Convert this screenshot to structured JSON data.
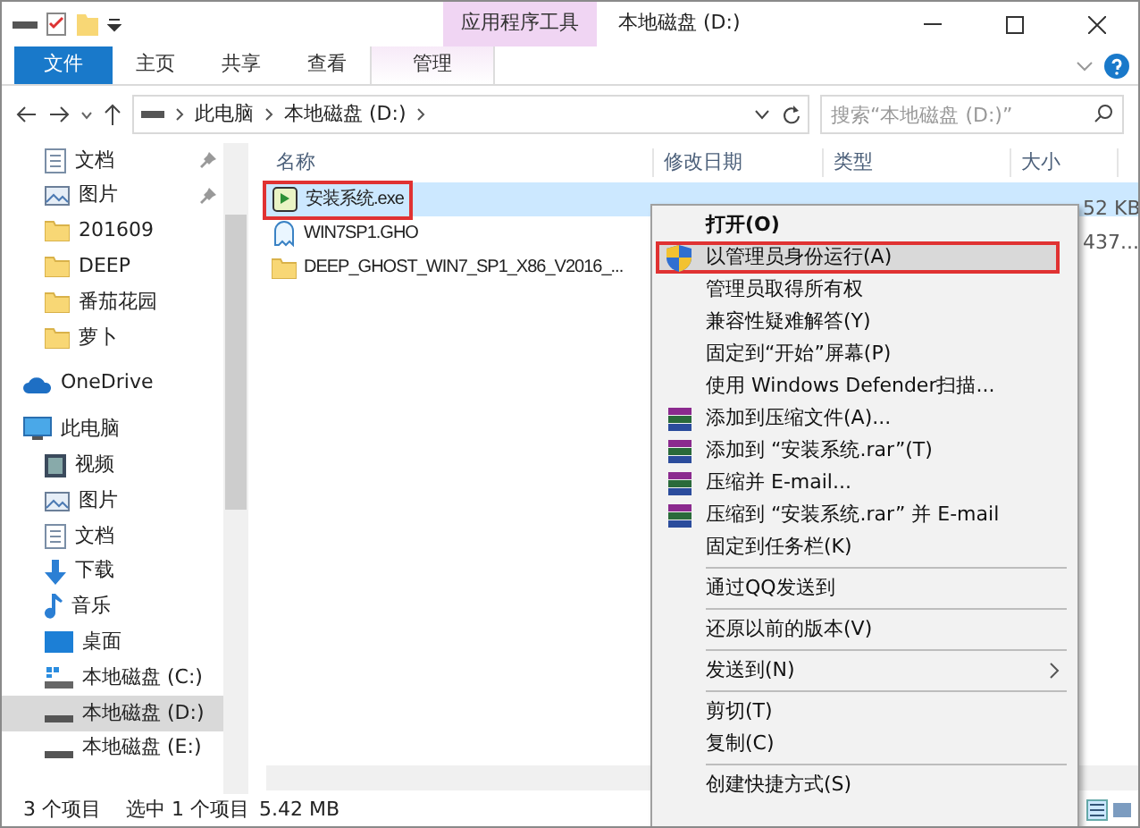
{
  "window": {
    "title": "本地磁盘 (D:)",
    "contextual_tab_group": "应用程序工具"
  },
  "ribbon_tabs": [
    {
      "label": "文件",
      "kind": "file",
      "selected": false
    },
    {
      "label": "主页",
      "kind": "normal",
      "selected": false
    },
    {
      "label": "共享",
      "kind": "normal",
      "selected": false
    },
    {
      "label": "查看",
      "kind": "normal",
      "selected": false
    },
    {
      "label": "管理",
      "kind": "contextual",
      "selected": false
    }
  ],
  "address_bar": {
    "breadcrumbs": [
      "此电脑",
      "本地磁盘 (D:)"
    ]
  },
  "search": {
    "placeholder": "搜索“本地磁盘 (D:)”"
  },
  "nav_tree": [
    {
      "label": "文档",
      "kind": "doc",
      "pinned": true,
      "selected": false
    },
    {
      "label": "图片",
      "kind": "pic",
      "pinned": true,
      "selected": false
    },
    {
      "label": "201609",
      "kind": "folder",
      "pinned": false,
      "selected": false
    },
    {
      "label": "DEEP",
      "kind": "folder",
      "pinned": false,
      "selected": false
    },
    {
      "label": "番茄花园",
      "kind": "folder",
      "pinned": false,
      "selected": false
    },
    {
      "label": "萝卜",
      "kind": "folder",
      "pinned": false,
      "selected": false
    },
    {
      "label": "OneDrive",
      "kind": "cloud",
      "pinned": false,
      "selected": false
    },
    {
      "label": "此电脑",
      "kind": "pc",
      "pinned": false,
      "selected": false,
      "children": [
        {
          "label": "视频",
          "kind": "video",
          "pinned": false,
          "selected": false
        },
        {
          "label": "图片",
          "kind": "pic",
          "pinned": false,
          "selected": false
        },
        {
          "label": "文档",
          "kind": "doc",
          "pinned": false,
          "selected": false
        },
        {
          "label": "下载",
          "kind": "download",
          "pinned": false,
          "selected": false
        },
        {
          "label": "音乐",
          "kind": "music",
          "pinned": false,
          "selected": false
        },
        {
          "label": "桌面",
          "kind": "desktop",
          "pinned": false,
          "selected": false
        },
        {
          "label": "本地磁盘 (C:)",
          "kind": "sysdrive",
          "pinned": false,
          "selected": false
        },
        {
          "label": "本地磁盘 (D:)",
          "kind": "drive",
          "pinned": false,
          "selected": true
        },
        {
          "label": "本地磁盘 (E:)",
          "kind": "drive",
          "pinned": false,
          "selected": false
        }
      ]
    }
  ],
  "table": {
    "columns": [
      "名称",
      "修改日期",
      "类型",
      "大小"
    ],
    "rows": [
      {
        "name": "安装系统.exe",
        "kind": "exe",
        "size": "52 KB",
        "selected": true,
        "outlined": true
      },
      {
        "name": "WIN7SP1.GHO",
        "kind": "gho",
        "size": "437...",
        "selected": false,
        "outlined": false
      },
      {
        "name": "DEEP_GHOST_WIN7_SP1_X86_V2016_...",
        "kind": "folder",
        "selected": false,
        "outlined": false
      }
    ]
  },
  "context_menu": [
    {
      "kind": "default",
      "label": "打开(O)",
      "selected": false,
      "outlined": false
    },
    {
      "kind": "admin",
      "label": "以管理员身份运行(A)",
      "selected": true,
      "outlined": true
    },
    {
      "kind": "item",
      "label": "管理员取得所有权",
      "selected": false,
      "outlined": false
    },
    {
      "kind": "item",
      "label": "兼容性疑难解答(Y)",
      "selected": false,
      "outlined": false
    },
    {
      "kind": "item",
      "label": "固定到“开始”屏幕(P)",
      "selected": false,
      "outlined": false
    },
    {
      "kind": "item",
      "label": "使用 Windows Defender扫描...",
      "selected": false,
      "outlined": false
    },
    {
      "kind": "archive",
      "label": "添加到压缩文件(A)...",
      "selected": false,
      "outlined": false
    },
    {
      "kind": "archive",
      "label": "添加到 “安装系统.rar”(T)",
      "selected": false,
      "outlined": false
    },
    {
      "kind": "archive",
      "label": "压缩并 E-mail...",
      "selected": false,
      "outlined": false
    },
    {
      "kind": "archive",
      "label": "压缩到 “安装系统.rar” 并 E-mail",
      "selected": false,
      "outlined": false
    },
    {
      "kind": "item",
      "label": "固定到任务栏(K)",
      "selected": false,
      "outlined": false
    },
    {
      "kind": "separator"
    },
    {
      "kind": "item",
      "label": "通过QQ发送到",
      "selected": false,
      "outlined": false
    },
    {
      "kind": "separator"
    },
    {
      "kind": "item",
      "label": "还原以前的版本(V)",
      "selected": false,
      "outlined": false
    },
    {
      "kind": "separator"
    },
    {
      "kind": "submenu",
      "label": "发送到(N)",
      "selected": false,
      "outlined": false
    },
    {
      "kind": "separator"
    },
    {
      "kind": "item",
      "label": "剪切(T)",
      "selected": false,
      "outlined": false
    },
    {
      "kind": "item",
      "label": "复制(C)",
      "selected": false,
      "outlined": false
    },
    {
      "kind": "separator"
    },
    {
      "kind": "item",
      "label": "创建快捷方式(S)",
      "selected": false,
      "outlined": false
    }
  ],
  "status_bar": {
    "item_count": "3 个项目",
    "selection": "选中 1 个项目",
    "selection_size": "5.42 MB"
  }
}
